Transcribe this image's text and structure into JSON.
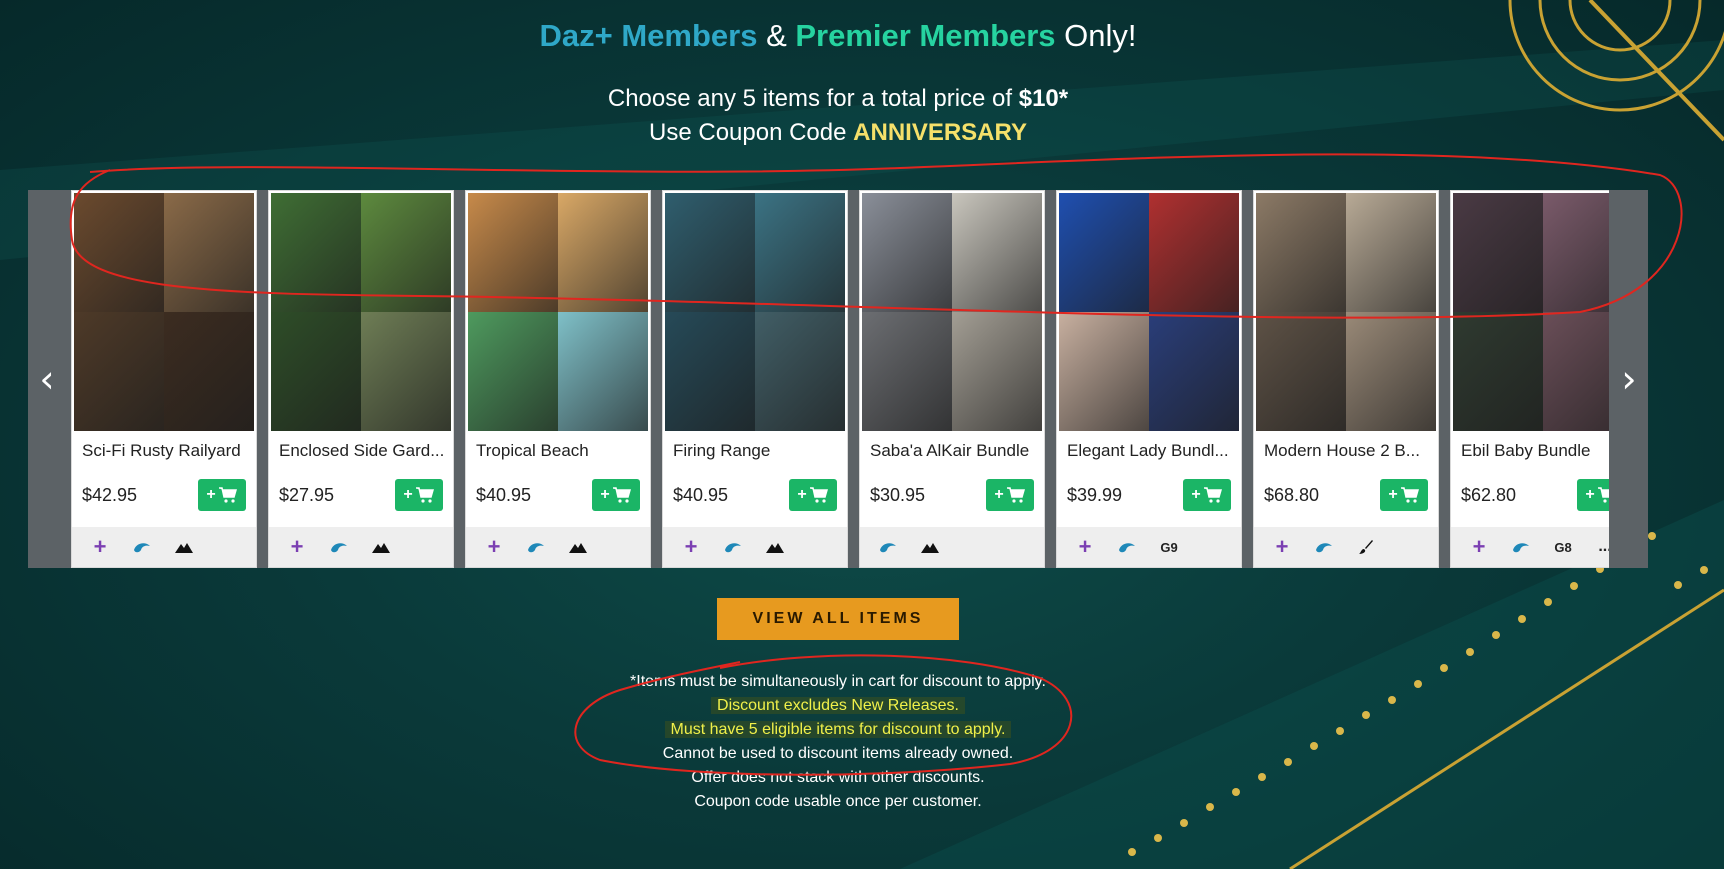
{
  "header": {
    "daz_plus": "Daz+ Members",
    "amp": " & ",
    "premier": "Premier Members",
    "only": " Only!",
    "offer_prefix": "Choose any 5 items for a total price of ",
    "offer_price": "$10*",
    "coupon_prefix": "Use Coupon Code ",
    "coupon_code": "ANNIVERSARY"
  },
  "carousel": {
    "prev_icon": "chevron-left-icon",
    "next_icon": "chevron-right-icon",
    "cart_label": "+",
    "products": [
      {
        "name": "Sci-Fi Rusty Railyard",
        "price": "$42.95",
        "icons": [
          "plus",
          "daz",
          "terrain"
        ],
        "colors": [
          "#6b4a2e",
          "#8a6a48",
          "#4e3a28",
          "#3c2c20"
        ]
      },
      {
        "name": "Enclosed Side Gard...",
        "price": "$27.95",
        "icons": [
          "plus",
          "daz",
          "terrain"
        ],
        "colors": [
          "#3f6e34",
          "#5d8a3e",
          "#2e4d28",
          "#6e7d55"
        ]
      },
      {
        "name": "Tropical Beach",
        "price": "$40.95",
        "icons": [
          "plus",
          "daz",
          "terrain"
        ],
        "colors": [
          "#c78a4a",
          "#d9a866",
          "#4e9a5e",
          "#7fc0c8"
        ]
      },
      {
        "name": "Firing Range",
        "price": "$40.95",
        "icons": [
          "plus",
          "daz",
          "terrain"
        ],
        "colors": [
          "#2f5e6e",
          "#3b7384",
          "#264a58",
          "#415e66"
        ]
      },
      {
        "name": "Saba'a AlKair Bundle",
        "price": "$30.95",
        "icons": [
          "daz",
          "terrain"
        ],
        "colors": [
          "#8a8f99",
          "#c9c6bd",
          "#6c6e72",
          "#a39e94"
        ]
      },
      {
        "name": "Elegant Lady Bundl...",
        "price": "$39.99",
        "icons": [
          "plus",
          "daz",
          "G9"
        ],
        "colors": [
          "#1f4fb0",
          "#b03030",
          "#c8b0a0",
          "#2a3e7a"
        ]
      },
      {
        "name": "Modern House 2 B...",
        "price": "$68.80",
        "icons": [
          "plus",
          "daz",
          "brush"
        ],
        "colors": [
          "#8c7a66",
          "#b8aa96",
          "#5e5246",
          "#9a8a78"
        ]
      },
      {
        "name": "Ebil Baby Bundle",
        "price": "$62.80",
        "icons": [
          "plus",
          "daz",
          "G8",
          "..."
        ],
        "colors": [
          "#4a3a44",
          "#7a5a6a",
          "#2f3a30",
          "#6a4e58"
        ]
      }
    ]
  },
  "view_all_label": "VIEW ALL ITEMS",
  "notes": {
    "line1": "*Items must be simultaneously in cart for discount to apply.",
    "line2": "Discount excludes New Releases.",
    "line3": "Must have 5 eligible items for discount to apply.",
    "line4": "Cannot be used to discount items already owned.",
    "line5": "Offer does not stack with other discounts.",
    "line6": "Coupon code usable once per customer."
  }
}
